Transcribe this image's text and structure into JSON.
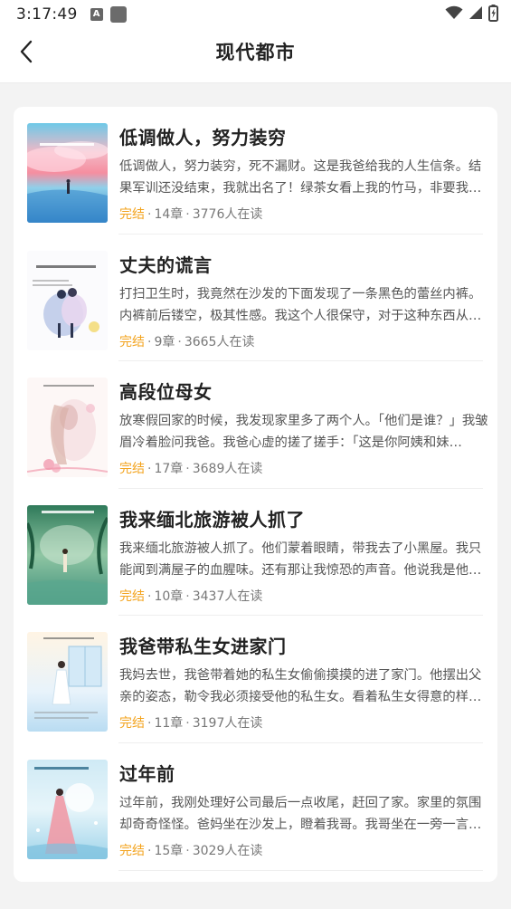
{
  "status_bar": {
    "time": "3:17:49",
    "notification_letter": "A",
    "icons": [
      "a-notification-icon",
      "app-notification-icon",
      "wifi-icon",
      "cellular-signal-icon",
      "battery-charging-icon"
    ]
  },
  "header": {
    "title": "现代都市",
    "back_icon": "chevron-left-icon"
  },
  "colors": {
    "status_completed": "#f3a31d",
    "background": "#f3f3f3",
    "card": "#ffffff"
  },
  "books": [
    {
      "title": "低调做人，努力装穷",
      "description": "低调做人，努力装穷，死不漏财。这是我爸给我的人生信条。结果军训还没结束，我就出名了！绿茶女看上我的竹马，非要我当她的垫脚石……",
      "status": "完结",
      "chapters": "14章",
      "readers": "3776人在读"
    },
    {
      "title": "丈夫的谎言",
      "description": "打扫卫生时，我竟然在沙发的下面发现了一条黑色的蕾丝内裤。内裤前后镂空，极其性感。我这个人很保守，对于这种东西从来不碰……",
      "status": "完结",
      "chapters": "9章",
      "readers": "3665人在读"
    },
    {
      "title": "高段位母女",
      "description": "放寒假回家的时候，我发现家里多了两个人。「他们是谁？」我皱眉冷着脸问我爸。我爸心虚的搓了搓手：「这是你阿姨和妹妹……」",
      "status": "完结",
      "chapters": "17章",
      "readers": "3689人在读"
    },
    {
      "title": "我来缅北旅游被人抓了",
      "description": "我来缅北旅游被人抓了。他们蒙着眼睛，带我去了小黑屋。我只能闻到满屋子的血腥味。还有那让我惊恐的声音。他说我是他们最值钱的货……",
      "status": "完结",
      "chapters": "10章",
      "readers": "3437人在读"
    },
    {
      "title": "我爸带私生女进家门",
      "description": "我妈去世，我爸带着她的私生女偷偷摸摸的进了家门。他摆出父亲的姿态，勒令我必须接受他的私生女。看着私生女得意的样子，我笑了……",
      "status": "完结",
      "chapters": "11章",
      "readers": "3197人在读"
    },
    {
      "title": "过年前",
      "description": "过年前，我刚处理好公司最后一点收尾，赶回了家。家里的氛围却奇奇怪怪。爸妈坐在沙发上，瞪着我哥。我哥坐在一旁一言不发……",
      "status": "完结",
      "chapters": "15章",
      "readers": "3029人在读"
    }
  ]
}
